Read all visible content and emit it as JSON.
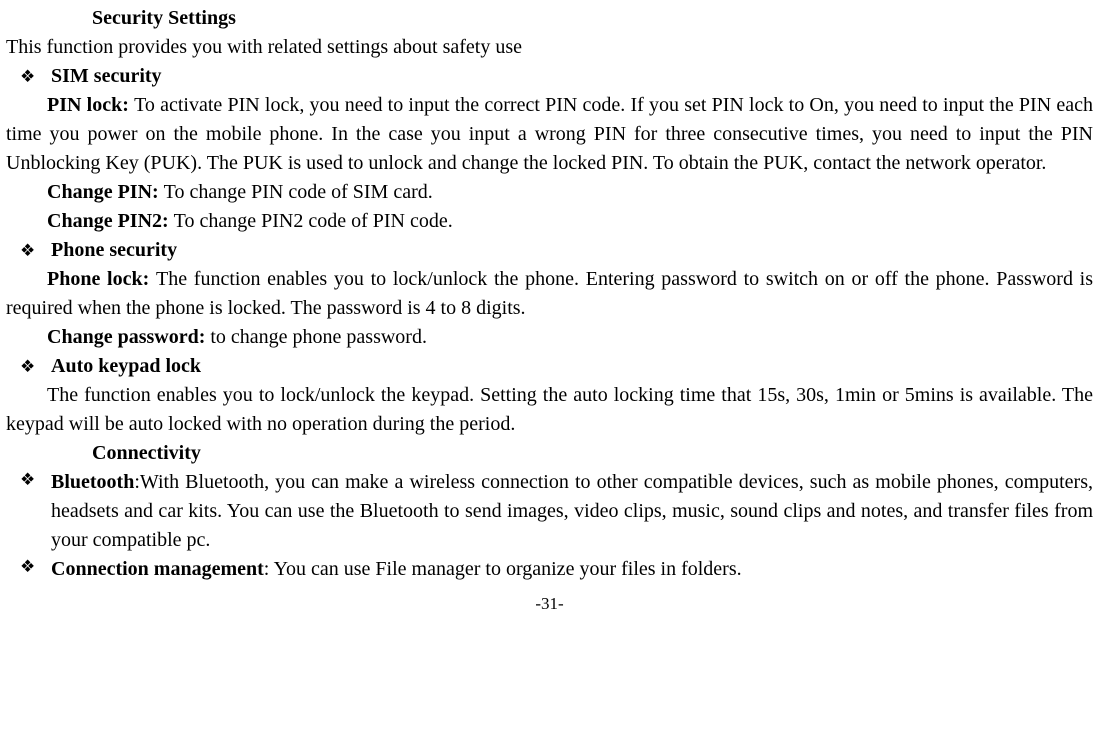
{
  "heading1": "Security Settings",
  "intro": "This function provides you with related settings about safety use",
  "bullet_glyph": "❖",
  "sim": {
    "title": "SIM security",
    "pin_lock_label": "PIN lock: ",
    "pin_lock_tail": "To activate PIN lock, you need to input the correct PIN code. If you set PIN lock to On, you need to input the PIN each time you power on the mobile phone. In the case you input a wrong PIN for three consecutive times, you need to input the PIN Unblocking Key (PUK). The PUK is used to unlock and change the locked PIN. To obtain the PUK, contact the network operator.",
    "change_pin_label": "Change PIN: ",
    "change_pin_tail": "To change PIN code of SIM card.",
    "change_pin2_label": "Change PIN2: ",
    "change_pin2_tail": "To change PIN2 code of PIN code."
  },
  "phone": {
    "title": "Phone security",
    "phone_lock_label": "Phone lock: ",
    "phone_lock_tail": "The function enables you to lock/unlock the phone. Entering password to switch on or off the phone. Password is required when the phone is locked. The password is 4 to 8 digits.",
    "change_pwd_label": "Change password: ",
    "change_pwd_tail": "to change phone password."
  },
  "autokeypad": {
    "title": "Auto keypad lock",
    "body": "The function enables you to lock/unlock the keypad. Setting the auto locking time that 15s, 30s, 1min or 5mins is available. The keypad will be auto locked with no operation during the period."
  },
  "heading2": "Connectivity",
  "bluetooth": {
    "label": "Bluetooth",
    "tail": ":With Bluetooth, you can make a wireless connection to other compatible devices, such as mobile phones, computers, headsets and car kits. You can use the Bluetooth to send images, video clips, music, sound clips and notes, and transfer files from your compatible pc."
  },
  "conn": {
    "label": "Connection management",
    "tail": ": You can use File manager to organize your files in folders."
  },
  "page": "-31-"
}
